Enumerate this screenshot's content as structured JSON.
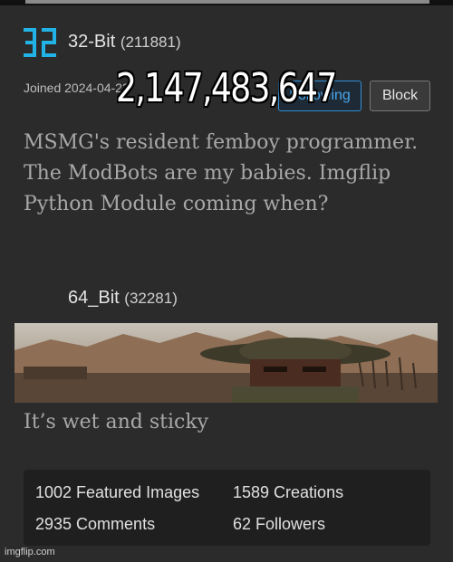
{
  "profile": {
    "username": "32-Bit",
    "points": "(211881)",
    "joined": "Joined 2024-04-23",
    "follow_label": "Following",
    "block_label": "Block",
    "bio": "MSMG's resident femboy programmer. The ModBots are my babies. Imgflip Python Module coming when?"
  },
  "overlay": {
    "number": "2,147,483,647"
  },
  "submission": {
    "username": "64_Bit",
    "points": "(32281)",
    "caption": "It’s wet and sticky"
  },
  "stats": {
    "featured": "1002 Featured Images",
    "creations": "1589 Creations",
    "comments": "2935 Comments",
    "followers": "62 Followers"
  },
  "watermark": "imgflip.com",
  "colors": {
    "accent": "#2f8fd8",
    "avatar": "#22b3e6",
    "background": "#2b2b2b"
  }
}
